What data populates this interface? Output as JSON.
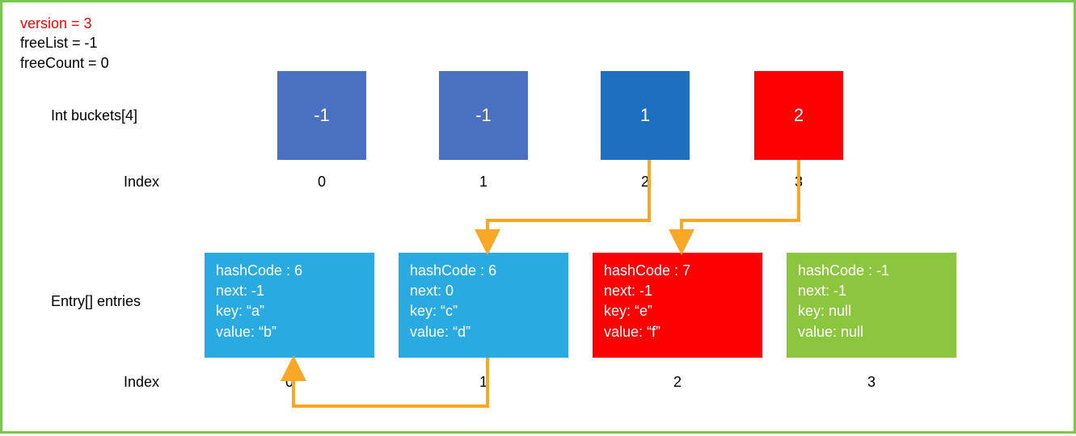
{
  "meta": {
    "version_label": "version = 3",
    "freeList_label": "freeList = -1",
    "freeCount_label": "freeCount = 0"
  },
  "labels": {
    "buckets_title": "Int buckets[4]",
    "index_word": "Index",
    "entries_title": "Entry[] entries"
  },
  "buckets": [
    {
      "value": "-1",
      "index": "0",
      "color": "#4a71c0"
    },
    {
      "value": "-1",
      "index": "1",
      "color": "#4a71c0"
    },
    {
      "value": "1",
      "index": "2",
      "color": "#1f6fc0"
    },
    {
      "value": "2",
      "index": "3",
      "color": "#ff0000"
    }
  ],
  "entries": [
    {
      "hash": "hashCode : 6",
      "next": "next: -1",
      "key": "key: “a”",
      "val": "value: “b”",
      "index": "0",
      "color": "#29abe2"
    },
    {
      "hash": "hashCode : 6",
      "next": "next: 0",
      "key": "key: “c”",
      "val": "value: “d”",
      "index": "1",
      "color": "#29abe2"
    },
    {
      "hash": "hashCode : 7",
      "next": "next: -1",
      "key": "key: “e”",
      "val": "value: “f”",
      "index": "2",
      "color": "#ff0000"
    },
    {
      "hash": "hashCode : -1",
      "next": "next: -1",
      "key": "key: null",
      "val": "value: null",
      "index": "3",
      "color": "#8cc63f"
    }
  ]
}
